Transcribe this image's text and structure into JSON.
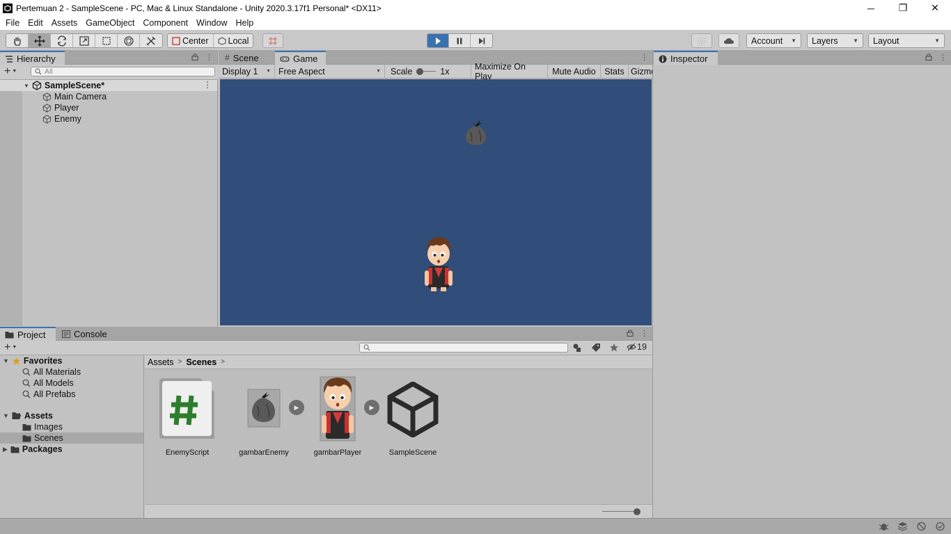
{
  "window": {
    "title": "Pertemuan 2 - SampleScene - PC, Mac & Linux Standalone - Unity 2020.3.17f1 Personal* <DX11>",
    "minimize": "─",
    "maximize": "❐",
    "close": "✕"
  },
  "menu": [
    "File",
    "Edit",
    "Assets",
    "GameObject",
    "Component",
    "Window",
    "Help"
  ],
  "toolbar": {
    "pivot_label": "Center",
    "space_label": "Local",
    "account_label": "Account",
    "layers_label": "Layers",
    "layout_label": "Layout"
  },
  "hierarchy": {
    "tab_label": "Hierarchy",
    "search_placeholder": "All",
    "scene_name": "SampleScene*",
    "items": [
      "Main Camera",
      "Player",
      "Enemy"
    ]
  },
  "gameview": {
    "scene_tab": "Scene",
    "game_tab": "Game",
    "display": "Display 1",
    "aspect": "Free Aspect",
    "scale_label": "Scale",
    "scale_value": "1x",
    "maximize_on_play": "Maximize On Play",
    "mute_audio": "Mute Audio",
    "stats": "Stats",
    "gizmos": "Gizmo",
    "background_color": "#314d79"
  },
  "inspector": {
    "tab_label": "Inspector"
  },
  "project": {
    "project_tab": "Project",
    "console_tab": "Console",
    "hidden_count": "19",
    "favorites": {
      "label": "Favorites",
      "items": [
        "All Materials",
        "All Models",
        "All Prefabs"
      ]
    },
    "assets": {
      "label": "Assets",
      "items": [
        "Images",
        "Scenes"
      ]
    },
    "packages_label": "Packages",
    "breadcrumb": [
      "Assets",
      "Scenes"
    ],
    "asset_items": [
      "EnemyScript",
      "gambarEnemy",
      "gambarPlayer",
      "SampleScene"
    ]
  },
  "colors": {
    "accent": "#3a72b0",
    "panel": "#c2c2c2",
    "tabbar": "#a5a5a5"
  }
}
